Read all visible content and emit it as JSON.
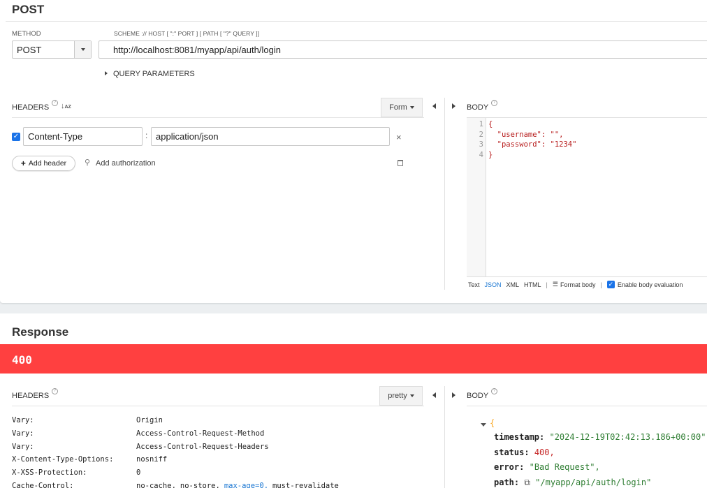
{
  "request": {
    "method_title": "POST",
    "method_label": "METHOD",
    "method_value": "POST",
    "url_hint": "SCHEME :// HOST [ \":\" PORT ] [ PATH [ \"?\" QUERY ]]",
    "url_value": "http://localhost:8081/myapp/api/auth/login",
    "query_params_label": "QUERY PARAMETERS",
    "headers_label": "HEADERS",
    "form_button": "Form",
    "header_rows": [
      {
        "checked": true,
        "name": "Content-Type",
        "value": "application/json"
      }
    ],
    "add_header": "Add header",
    "add_authorization": "Add authorization",
    "body_label": "BODY",
    "body_lines": [
      {
        "num": "1",
        "text": "{"
      },
      {
        "num": "2",
        "text": "  \"username\": \"\","
      },
      {
        "num": "3",
        "text": "  \"password\": \"1234\""
      },
      {
        "num": "4",
        "text": "}"
      }
    ],
    "body_formats": [
      "Text",
      "JSON",
      "XML",
      "HTML"
    ],
    "body_format_active": "JSON",
    "format_body": "Format body",
    "enable_body_eval": "Enable body evaluation"
  },
  "response": {
    "title": "Response",
    "status_code": "400",
    "status_color": "#ff4040",
    "headers_label": "HEADERS",
    "pretty_button": "pretty",
    "body_label": "BODY",
    "headers": [
      {
        "key": "Vary:",
        "value": [
          "Origin"
        ]
      },
      {
        "key": "Vary:",
        "value": [
          "Access-Control-Request-Method"
        ]
      },
      {
        "key": "Vary:",
        "value": [
          "Access-Control-Request-Headers"
        ]
      },
      {
        "key": "X-Content-Type-Options:",
        "value": [
          "nosniff"
        ]
      },
      {
        "key": "X-XSS-Protection:",
        "value": [
          "0"
        ]
      },
      {
        "key": "Cache-Control:",
        "value": [
          "no-cache,",
          "no-store,",
          "max-age=0,",
          "must-revalidate"
        ]
      }
    ],
    "body_open_brace": "{",
    "body_fields": [
      {
        "key": "timestamp:",
        "value": "\"2024-12-19T02:42:13.186+00:00\",",
        "type": "string"
      },
      {
        "key": "status:",
        "value": "400,",
        "type": "number"
      },
      {
        "key": "error:",
        "value": "\"Bad Request\",",
        "type": "string"
      },
      {
        "key": "path:",
        "value": "\"/myapp/api/auth/login\"",
        "type": "link"
      }
    ]
  }
}
